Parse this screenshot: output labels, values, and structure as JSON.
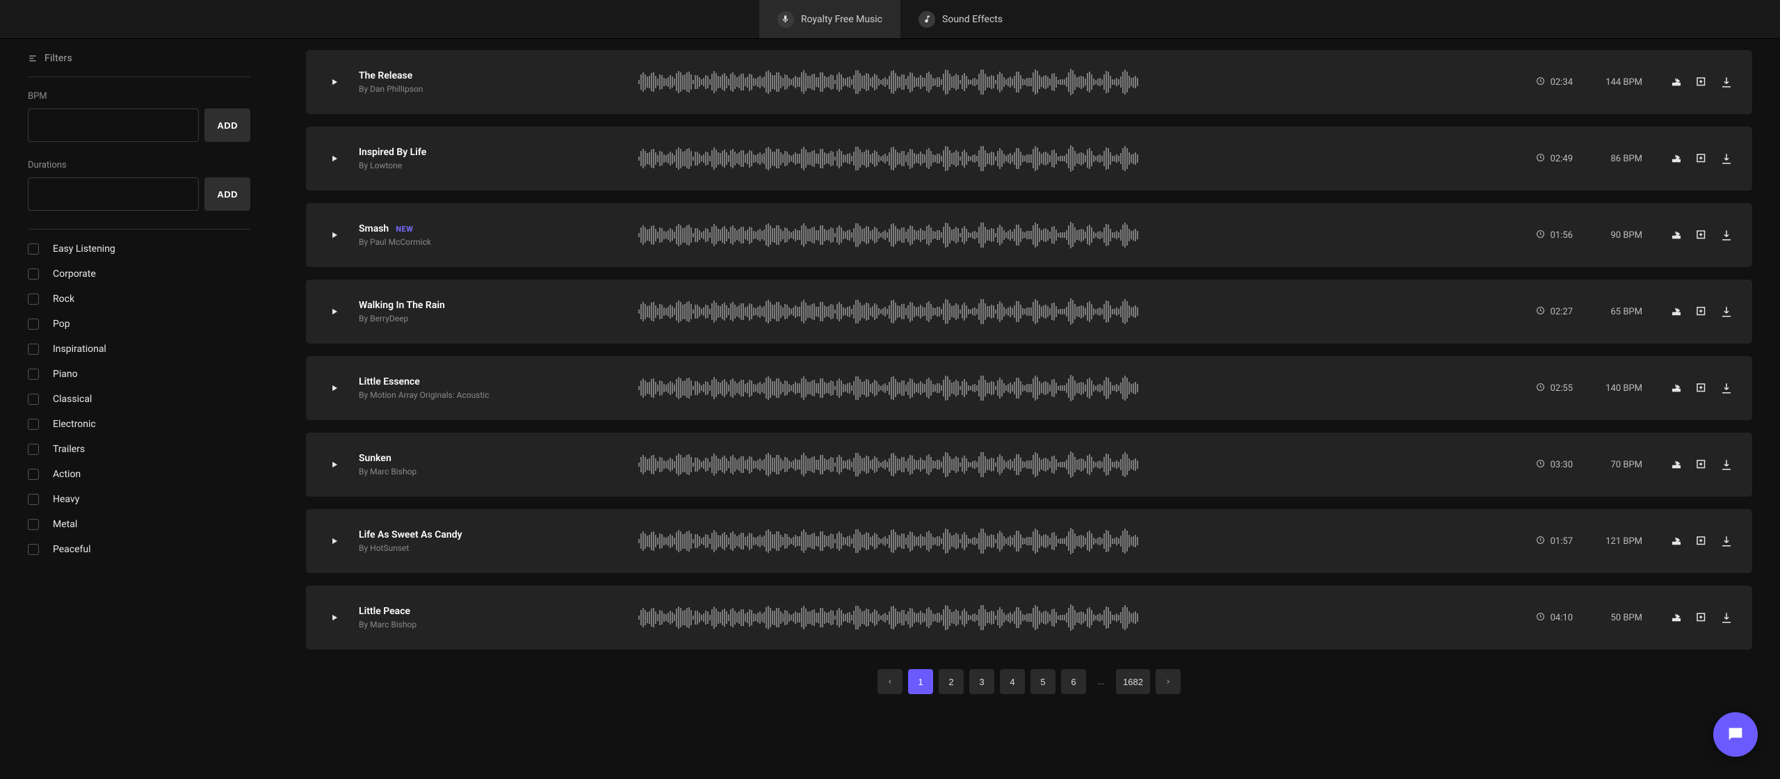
{
  "tabs": {
    "music": "Royalty Free Music",
    "sfx": "Sound Effects"
  },
  "sidebar": {
    "filters_heading": "Filters",
    "bpm_label": "BPM",
    "durations_label": "Durations",
    "add_label": "ADD",
    "categories": [
      "Easy Listening",
      "Corporate",
      "Rock",
      "Pop",
      "Inspirational",
      "Piano",
      "Classical",
      "Electronic",
      "Trailers",
      "Action",
      "Heavy",
      "Metal",
      "Peaceful"
    ]
  },
  "tracks": [
    {
      "title": "The Release",
      "artist_prefix": "By ",
      "artist": "Dan Phillipson",
      "duration": "02:34",
      "bpm": "144 BPM",
      "new": false
    },
    {
      "title": "Inspired By Life",
      "artist_prefix": "By ",
      "artist": "Lowtone",
      "duration": "02:49",
      "bpm": "86 BPM",
      "new": false
    },
    {
      "title": "Smash",
      "artist_prefix": "By ",
      "artist": "Paul McCormick",
      "duration": "01:56",
      "bpm": "90 BPM",
      "new": true,
      "new_label": "NEW"
    },
    {
      "title": "Walking In The Rain",
      "artist_prefix": "By ",
      "artist": "BerryDeep",
      "duration": "02:27",
      "bpm": "65 BPM",
      "new": false
    },
    {
      "title": "Little Essence",
      "artist_prefix": "By ",
      "artist": "Motion Array Originals: Acoustic",
      "duration": "02:55",
      "bpm": "140 BPM",
      "new": false
    },
    {
      "title": "Sunken",
      "artist_prefix": "By ",
      "artist": "Marc Bishop",
      "duration": "03:30",
      "bpm": "70 BPM",
      "new": false
    },
    {
      "title": "Life As Sweet As Candy",
      "artist_prefix": "By ",
      "artist": "HotSunset",
      "duration": "01:57",
      "bpm": "121 BPM",
      "new": false
    },
    {
      "title": "Little Peace",
      "artist_prefix": "By ",
      "artist": "Marc Bishop",
      "duration": "04:10",
      "bpm": "50 BPM",
      "new": false
    }
  ],
  "pagination": {
    "pages": [
      "1",
      "2",
      "3",
      "4",
      "5",
      "6"
    ],
    "ellipsis": "...",
    "last": "1682",
    "active": "1"
  }
}
